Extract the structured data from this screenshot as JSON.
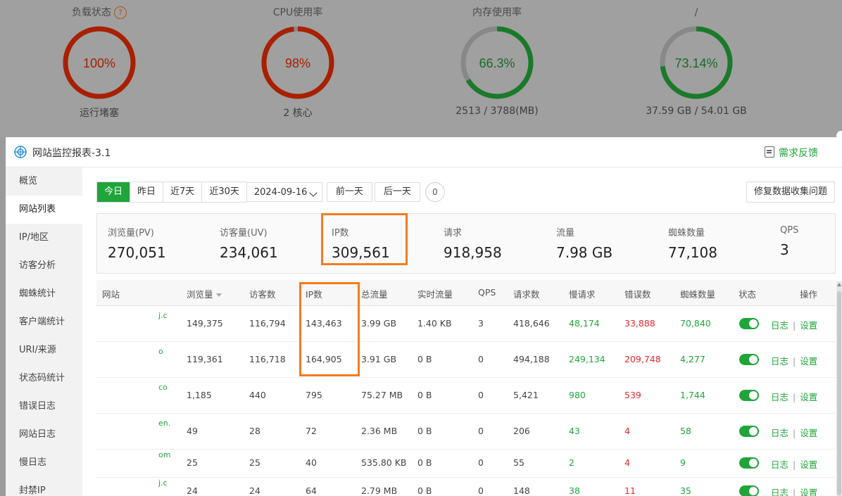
{
  "gauges": [
    {
      "title": "负载状态",
      "value": "100%",
      "sub": "运行堵塞",
      "pct": 1.0,
      "arc_color": "#a82000",
      "text_color": "#a82000",
      "help": "?"
    },
    {
      "title": "CPU使用率",
      "value": "98%",
      "sub": "2 核心",
      "pct": 0.98,
      "arc_color": "#a82000",
      "text_color": "#a82000"
    },
    {
      "title": "内存使用率",
      "value": "66.3%",
      "sub": "2513 / 3788(MB)",
      "pct": 0.663,
      "arc_color": "#1b7a2a",
      "text_color": "#1b6a28"
    },
    {
      "title": "/",
      "value": "73.14%",
      "sub": "37.59 GB / 54.01 GB",
      "pct": 0.7314,
      "arc_color": "#1b7a2a",
      "text_color": "#1b6a28"
    }
  ],
  "modal": {
    "title": "网站监控报表-3.1",
    "feedback": "需求反馈"
  },
  "sidebar": {
    "items": [
      "概览",
      "网站列表",
      "IP/地区",
      "访客分析",
      "蜘蛛统计",
      "客户端统计",
      "URI/来源",
      "状态码统计",
      "错误日志",
      "网站日志",
      "慢日志",
      "封禁IP"
    ],
    "active_index": 1
  },
  "toolbar": {
    "ranges": [
      "今日",
      "昨日",
      "近7天",
      "近30天"
    ],
    "active_range": 0,
    "date": "2024-09-16",
    "prev_day": "前一天",
    "next_day": "后一天",
    "count": "0",
    "fix": "修复数据收集问题"
  },
  "stats": [
    {
      "label": "浏览量(PV)",
      "value": "270,051"
    },
    {
      "label": "访客量(UV)",
      "value": "234,061"
    },
    {
      "label": "IP数",
      "value": "309,561"
    },
    {
      "label": "请求",
      "value": "918,958"
    },
    {
      "label": "流量",
      "value": "7.98 GB"
    },
    {
      "label": "蜘蛛数量",
      "value": "77,108"
    },
    {
      "label": "QPS",
      "value": "3"
    }
  ],
  "table": {
    "headers": [
      "网站",
      "浏览量",
      "访客数",
      "IP数",
      "总流量",
      "实时流量",
      "QPS",
      "请求数",
      "慢请求",
      "错误数",
      "蜘蛛数量",
      "状态",
      "操作"
    ],
    "log_label": "日志",
    "sep": "|",
    "settings_label": "设置",
    "rows": [
      {
        "site": "j.c",
        "pv": "149,375",
        "uv": "116,794",
        "ip": "143,463",
        "traffic": "3.99 GB",
        "realtime": "1.40 KB",
        "qps": "3",
        "req": "418,646",
        "slow": "48,174",
        "err": "33,888",
        "spider": "70,840"
      },
      {
        "site": "o",
        "pv": "119,361",
        "uv": "116,718",
        "ip": "164,905",
        "traffic": "3.91 GB",
        "realtime": "0 B",
        "qps": "0",
        "req": "494,188",
        "slow": "249,134",
        "err": "209,748",
        "spider": "4,277"
      },
      {
        "site": "co",
        "pv": "1,185",
        "uv": "440",
        "ip": "795",
        "traffic": "75.27 MB",
        "realtime": "0 B",
        "qps": "0",
        "req": "5,421",
        "slow": "980",
        "err": "539",
        "spider": "1,744"
      },
      {
        "site": "en.",
        "pv": "49",
        "uv": "28",
        "ip": "72",
        "traffic": "2.36 MB",
        "realtime": "0 B",
        "qps": "0",
        "req": "206",
        "slow": "43",
        "err": "4",
        "spider": "58"
      },
      {
        "site": "om",
        "pv": "25",
        "uv": "25",
        "ip": "40",
        "traffic": "535.80 KB",
        "realtime": "0 B",
        "qps": "0",
        "req": "55",
        "slow": "2",
        "err": "4",
        "spider": "9"
      },
      {
        "site": "j.c",
        "pv": "24",
        "uv": "24",
        "ip": "64",
        "traffic": "2.79 MB",
        "realtime": "0 B",
        "qps": "0",
        "req": "148",
        "slow": "38",
        "err": "11",
        "spider": "35"
      }
    ]
  }
}
